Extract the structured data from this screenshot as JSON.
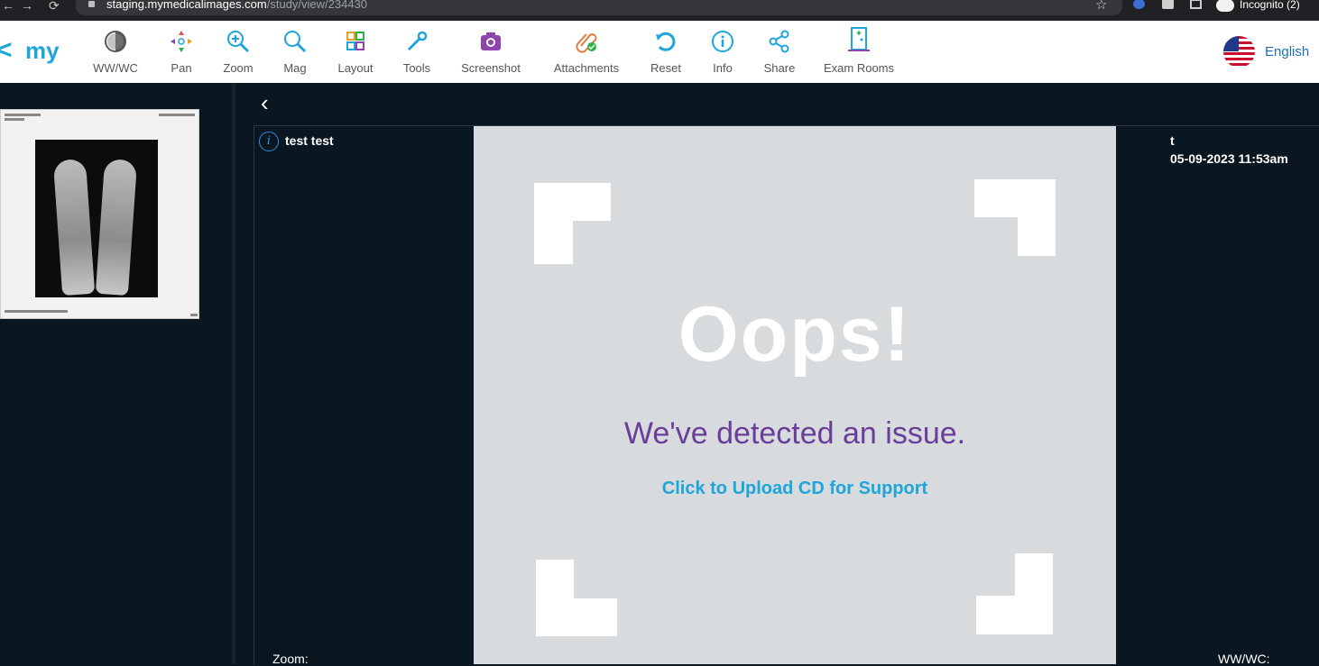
{
  "browser": {
    "url_host": "staging.mymedicalimages.com",
    "url_path": "/study/view/234430",
    "incognito_label": "Incognito (2)"
  },
  "app": {
    "logo_text": "my",
    "tools": [
      {
        "label": "WW/WC",
        "icon": "contrast-icon",
        "color": "#555555"
      },
      {
        "label": "Pan",
        "icon": "pan-icon",
        "color": "#e24b4b"
      },
      {
        "label": "Zoom",
        "icon": "zoom-in-icon",
        "color": "#1ea5d9"
      },
      {
        "label": "Mag",
        "icon": "magnifier-icon",
        "color": "#1ea5d9"
      },
      {
        "label": "Layout",
        "icon": "layout-grid-icon",
        "color": "#e5a11e"
      },
      {
        "label": "Tools",
        "icon": "wrench-icon",
        "color": "#1ea5d9"
      },
      {
        "label": "Screenshot",
        "icon": "camera-icon",
        "color": "#8e44ad"
      },
      {
        "label": "Attachments",
        "icon": "paperclip-icon",
        "color": "#e07b39"
      },
      {
        "label": "Reset",
        "icon": "reset-icon",
        "color": "#1ea5d9"
      },
      {
        "label": "Info",
        "icon": "info-icon",
        "color": "#1ea5d9"
      },
      {
        "label": "Share",
        "icon": "share-icon",
        "color": "#1ea5d9"
      },
      {
        "label": "Exam Rooms",
        "icon": "door-icon",
        "color": "#1ea5d9"
      }
    ],
    "language": "English"
  },
  "viewer": {
    "patient_name": "test test",
    "top_right_line1": "t",
    "top_right_line2": "05-09-2023 11:53am",
    "zoom_label": "Zoom:",
    "wwwc_label": "WW/WC:"
  },
  "error": {
    "headline": "Oops!",
    "message": "We've detected an issue.",
    "action": "Click to Upload CD for Support"
  }
}
